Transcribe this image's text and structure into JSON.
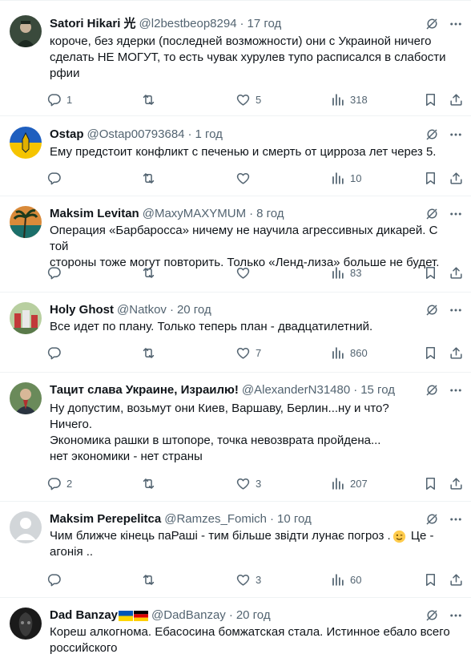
{
  "posts": [
    {
      "name": "Satori Hikari 光",
      "handle": "@l2bestbeop8294",
      "time": "17 год",
      "text": "короче, без ядерки (последней возможности) они с Украиной ничего\nсделать НЕ МОГУТ, то есть чувак хурулев тупо расписался в слабости\nрфии",
      "replies": "1",
      "retweets": "",
      "likes": "5",
      "views": "318"
    },
    {
      "name": "Ostap",
      "handle": "@Ostap00793684",
      "time": "1 год",
      "text": "Ему предстоит конфликт с печенью и смерть от цирроза лет через 5.",
      "replies": "",
      "retweets": "",
      "likes": "",
      "views": "10"
    },
    {
      "name": "Maksim Levitan",
      "handle": "@MaxyMAXYMUM",
      "time": "8 год",
      "text": "Операция «Барбаросса» ничему не научила агрессивных дикарей. С той\nстороны тоже могут повторить. Только «Ленд-лиза»  больше не будет.",
      "replies": "",
      "retweets": "",
      "likes": "",
      "views": "83"
    },
    {
      "name": "Holy Ghost",
      "handle": "@Natkov",
      "time": "20 год",
      "text": "Все идет по плану. Только теперь план - двадцатилетний.",
      "replies": "",
      "retweets": "",
      "likes": "7",
      "views": "860"
    },
    {
      "name": "Тацит слава Украине, Израилю!",
      "handle": "@AlexanderN31480",
      "time": "15 год",
      "text": "Ну допустим, возьмут они Киев, Варшаву, Берлин...ну и что?\nНичего.\nЭкономика рашки в штопоре, точка невозврата пройдена...\nнет экономики - нет страны",
      "replies": "2",
      "retweets": "",
      "likes": "3",
      "views": "207"
    },
    {
      "name": "Maksim Perepelitca",
      "handle": "@Ramzes_Fomich",
      "time": "10 год",
      "text_a": "Чим ближче кінець паРаші - тим більше звідти лунає погроз .",
      "text_b": " Це -\nагонія ..",
      "replies": "",
      "retweets": "",
      "likes": "3",
      "views": "60"
    },
    {
      "name": "Dad Banzay",
      "handle": "@DadBanzay",
      "time": "20 год",
      "text": "Кореш алкогнома. Ебасосина бомжатская стала. Истинное ебало всего\nроссийского"
    }
  ],
  "separator": "·",
  "colors": {
    "text": "#0f1419",
    "secondary": "#536471",
    "border": "#eff3f4"
  },
  "icons": [
    "grok-icon",
    "more-icon",
    "reply-icon",
    "retweet-icon",
    "like-icon",
    "views-icon",
    "bookmark-icon",
    "share-icon"
  ]
}
